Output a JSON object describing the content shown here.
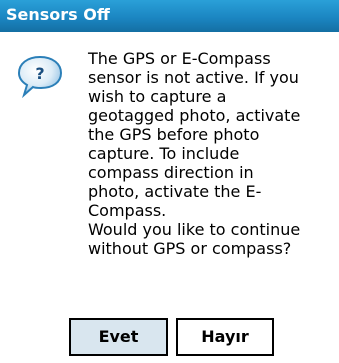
{
  "dialog": {
    "title": "Sensors Off",
    "icon": "question-bubble-icon",
    "message": "The GPS or E-Compass\nsensor is not active. If you\nwish to capture a\ngeotagged photo, activate\nthe GPS before photo\ncapture. To include\ncompass direction in\nphoto, activate the E-\nCompass.\nWould you like to continue\nwithout GPS or compass?",
    "buttons": {
      "yes_label": "Evet",
      "no_label": "Hayır"
    }
  },
  "colors": {
    "titlebar": "#1b86c2",
    "button_default_bg": "#d9e6ef",
    "icon_accent": "#2b7fb8"
  }
}
